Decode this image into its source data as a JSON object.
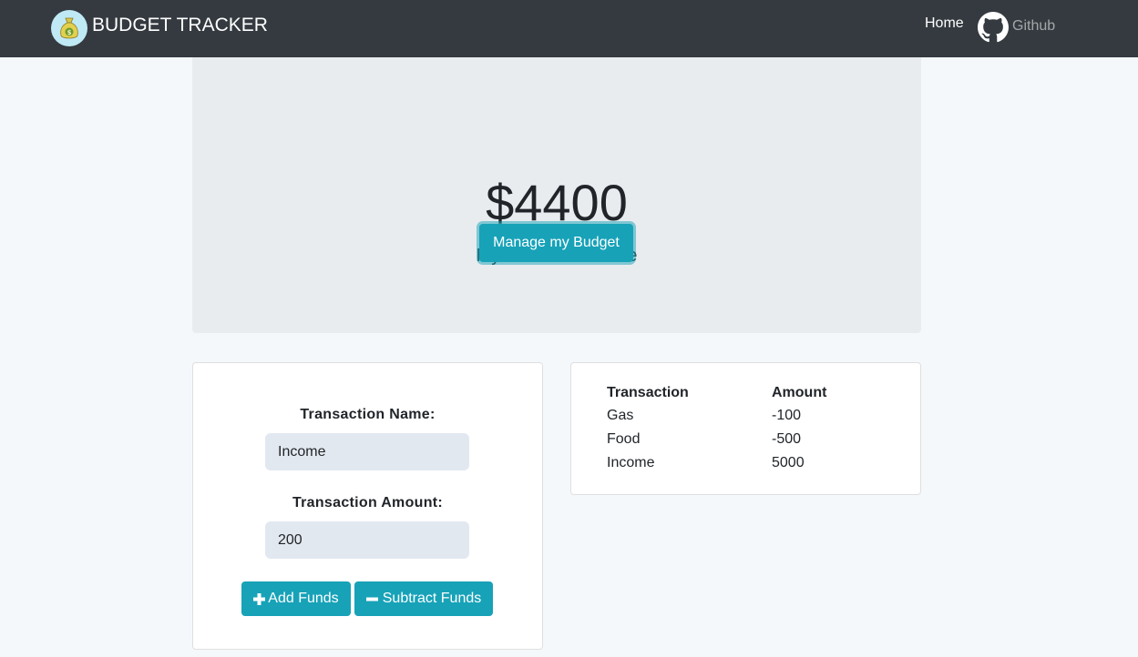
{
  "nav": {
    "brand": "BUDGET TRACKER",
    "logo_icon": "money-bag-icon",
    "home": "Home",
    "github": "Github",
    "github_icon": "github-icon"
  },
  "jumbotron": {
    "balance": "$4400",
    "balance_label": "My Current Balance",
    "manage_button": "Manage my Budget"
  },
  "form": {
    "name_label": "Transaction Name:",
    "name_value": "Income",
    "amount_label": "Transaction Amount:",
    "amount_value": "200",
    "add_button": "Add Funds",
    "subtract_button": "Subtract Funds",
    "add_icon": "plus-icon",
    "subtract_icon": "minus-icon"
  },
  "table": {
    "headers": [
      "Transaction",
      "Amount"
    ],
    "rows": [
      [
        "Gas",
        "-100"
      ],
      [
        "Food",
        "-500"
      ],
      [
        "Income",
        "5000"
      ]
    ]
  },
  "colors": {
    "navbar": "#343a40",
    "accent": "#17a2b8",
    "jumbotron": "#e9ecef",
    "background": "#f5f8fb"
  }
}
